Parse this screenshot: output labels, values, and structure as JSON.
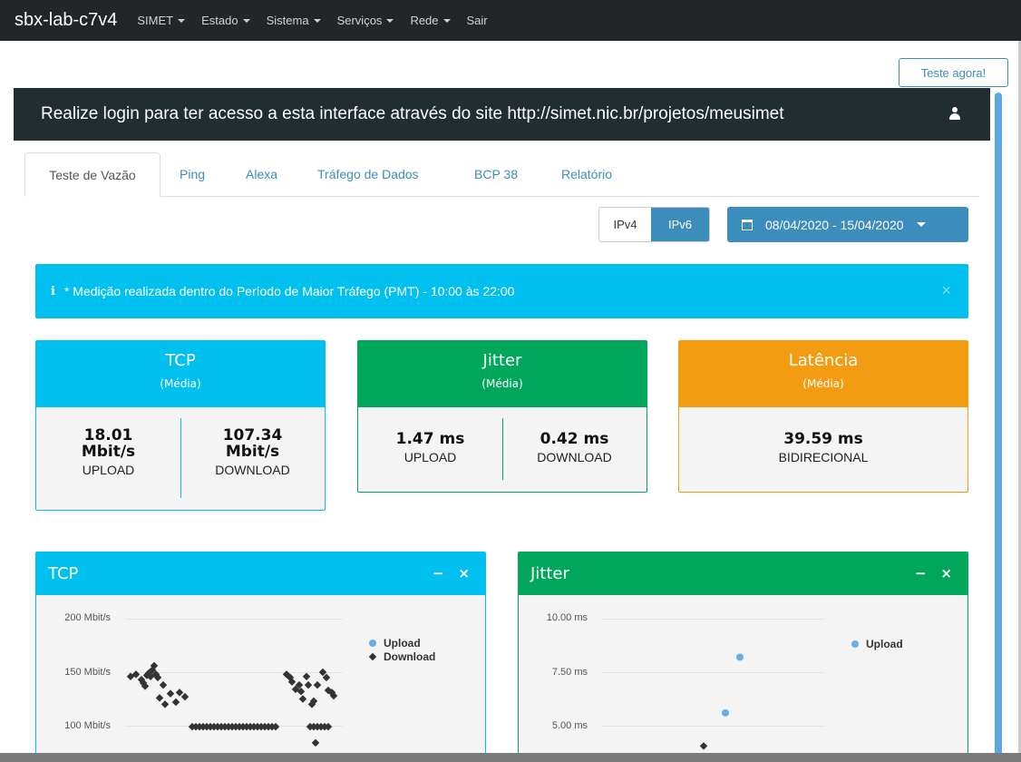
{
  "navbar": {
    "brand": "sbx-lab-c7v4",
    "items": [
      {
        "label": "SIMET",
        "dropdown": true
      },
      {
        "label": "Estado",
        "dropdown": true
      },
      {
        "label": "Sistema",
        "dropdown": true
      },
      {
        "label": "Serviços",
        "dropdown": true
      },
      {
        "label": "Rede",
        "dropdown": true
      },
      {
        "label": "Sair",
        "dropdown": false
      }
    ]
  },
  "test_button": "Teste agora!",
  "login_banner": {
    "text": "Realize login para ter acesso a esta interface através do site http://simet.nic.br/projetos/meusimet",
    "icon": "user-icon"
  },
  "tabs": [
    "Teste de Vazão",
    "Ping",
    "Alexa",
    "Tráfego de Dados",
    "BCP 38",
    "Relatório"
  ],
  "active_tab": "Teste de Vazão",
  "ip_toggle": {
    "options": [
      "IPv4",
      "IPv6"
    ],
    "selected": "IPv6"
  },
  "date_range": "08/04/2020 - 15/04/2020",
  "alert": {
    "icon": "info-icon",
    "text": "* Medição realizada dentro do Período de Maior Tráfego (PMT) - 10:00 às 22:00",
    "close": "×"
  },
  "stats": {
    "tcp": {
      "title": "TCP",
      "subtitle": "(Média)",
      "upload_value": "18.01",
      "upload_unit": "Mbit/s",
      "upload_label": "UPLOAD",
      "download_value": "107.34",
      "download_unit": "Mbit/s",
      "download_label": "DOWNLOAD"
    },
    "jitter": {
      "title": "Jitter",
      "subtitle": "(Média)",
      "upload_value": "1.47 ms",
      "upload_label": "UPLOAD",
      "download_value": "0.42 ms",
      "download_label": "DOWNLOAD"
    },
    "latency": {
      "title": "Latência",
      "subtitle": "(Média)",
      "value": "39.59 ms",
      "label": "BIDIRECIONAL"
    }
  },
  "colors": {
    "navbar": "#222629",
    "primary": "#3c8dbc",
    "aqua": "#00c0ef",
    "green": "#00a65a",
    "orange": "#f39c12",
    "banner": "#222d32"
  },
  "panels": {
    "tcp": {
      "title": "TCP",
      "minimize": "−",
      "close": "×"
    },
    "jitter": {
      "title": "Jitter",
      "minimize": "−",
      "close": "×"
    }
  },
  "chart_data": [
    {
      "type": "scatter",
      "title": "TCP",
      "yticks": [
        "200 Mbit/s",
        "150 Mbit/s",
        "100 Mbit/s"
      ],
      "ylim_visible": [
        90,
        200
      ],
      "legend": [
        "Upload",
        "Download"
      ],
      "series": [
        {
          "name": "Upload",
          "points": []
        },
        {
          "name": "Download",
          "points": [
            [
              2,
              146
            ],
            [
              5,
              148
            ],
            [
              8,
              143
            ],
            [
              9,
              140
            ],
            [
              10,
              137
            ],
            [
              11,
              147
            ],
            [
              12,
              149
            ],
            [
              13,
              146
            ],
            [
              14,
              152
            ],
            [
              15,
              156
            ],
            [
              16,
              148
            ],
            [
              17,
              145
            ],
            [
              18,
              126
            ],
            [
              20,
              138
            ],
            [
              21,
              120
            ],
            [
              24,
              130
            ],
            [
              27,
              122
            ],
            [
              29,
              131
            ],
            [
              32,
              127
            ],
            [
              36,
              99
            ],
            [
              38,
              99
            ],
            [
              40,
              99
            ],
            [
              42,
              99
            ],
            [
              44,
              99
            ],
            [
              46,
              99
            ],
            [
              48,
              99
            ],
            [
              50,
              99
            ],
            [
              52,
              99
            ],
            [
              54,
              99
            ],
            [
              56,
              99
            ],
            [
              58,
              99
            ],
            [
              60,
              99
            ],
            [
              62,
              99
            ],
            [
              64,
              99
            ],
            [
              66,
              99
            ],
            [
              68,
              99
            ],
            [
              70,
              99
            ],
            [
              72,
              99
            ],
            [
              74,
              99
            ],
            [
              76,
              99
            ],
            [
              78,
              99
            ],
            [
              80,
              99
            ],
            [
              82,
              99
            ],
            [
              88,
              148
            ],
            [
              90,
              145
            ],
            [
              91,
              141
            ],
            [
              93,
              134
            ],
            [
              95,
              138
            ],
            [
              96,
              132
            ],
            [
              97,
              125
            ],
            [
              99,
              146
            ],
            [
              100,
              138
            ],
            [
              102,
              120
            ],
            [
              103,
              123
            ],
            [
              105,
              138
            ],
            [
              108,
              150
            ],
            [
              110,
              145
            ],
            [
              111,
              133
            ],
            [
              113,
              131
            ],
            [
              114,
              128
            ],
            [
              101,
              99
            ],
            [
              103,
              99
            ],
            [
              105,
              99
            ],
            [
              107,
              99
            ],
            [
              109,
              99
            ],
            [
              111,
              99
            ],
            [
              104,
              84
            ]
          ]
        }
      ]
    },
    {
      "type": "scatter",
      "title": "Jitter",
      "yticks": [
        "10.00 ms",
        "7.50 ms",
        "5.00 ms"
      ],
      "ylim_visible": [
        4.5,
        10
      ],
      "legend": [
        "Upload"
      ],
      "series": [
        {
          "name": "Upload",
          "points": [
            [
              8,
              8.2
            ],
            [
              6,
              5.6
            ]
          ]
        },
        {
          "name": "Download",
          "points": [
            [
              3,
              4.05
            ]
          ]
        }
      ]
    }
  ]
}
